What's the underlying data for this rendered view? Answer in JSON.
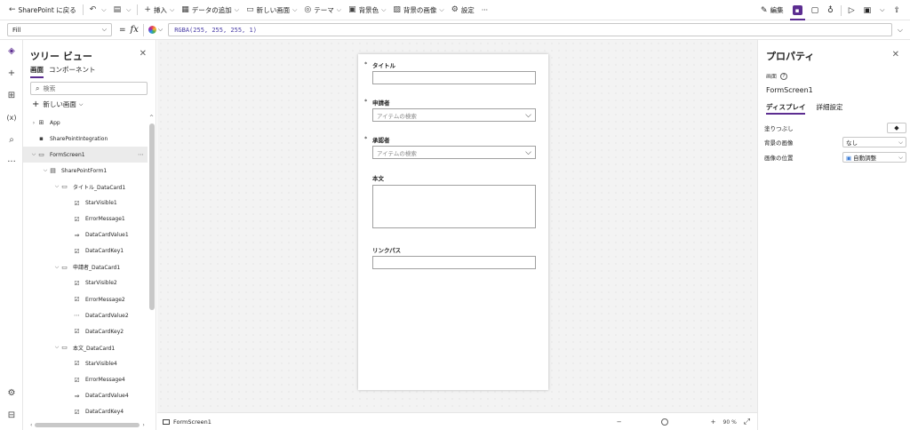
{
  "toolbar": {
    "back_label": "SharePoint に戻る",
    "insert_label": "挿入",
    "add_data_label": "データの追加",
    "new_screen_label": "新しい画面",
    "theme_label": "テーマ",
    "bg_color_label": "背景色",
    "bg_image_label": "背景の画像",
    "settings_label": "設定",
    "more_label": "···",
    "edit_label": "編集"
  },
  "formula_bar": {
    "property": "Fill",
    "equals": "=",
    "fx": "fx",
    "formula": "RGBA(255, 255, 255, 1)"
  },
  "tree_view": {
    "title": "ツリー ビュー",
    "tabs": [
      "画面",
      "コンポーネント"
    ],
    "search_placeholder": "検索",
    "new_screen": "新しい画面",
    "nodes": [
      {
        "label": "App",
        "icon": "app-icon"
      },
      {
        "label": "SharePointIntegration",
        "icon": "sharepoint-integration-icon"
      },
      {
        "label": "FormScreen1",
        "icon": "screen-icon"
      },
      {
        "label": "SharePointForm1",
        "icon": "form-icon"
      },
      {
        "label": "タイトル_DataCard1",
        "icon": "datacard-icon"
      },
      {
        "label": "StarVisible1",
        "icon": "label-icon"
      },
      {
        "label": "ErrorMessage1",
        "icon": "label-icon"
      },
      {
        "label": "DataCardValue1",
        "icon": "textinput-icon"
      },
      {
        "label": "DataCardKey1",
        "icon": "label-icon"
      },
      {
        "label": "申請者_DataCard1",
        "icon": "datacard-icon"
      },
      {
        "label": "StarVisible2",
        "icon": "label-icon"
      },
      {
        "label": "ErrorMessage2",
        "icon": "label-icon"
      },
      {
        "label": "DataCardValue2",
        "icon": "combobox-icon"
      },
      {
        "label": "DataCardKey2",
        "icon": "label-icon"
      },
      {
        "label": "本文_DataCard1",
        "icon": "datacard-icon"
      },
      {
        "label": "StarVisible4",
        "icon": "label-icon"
      },
      {
        "label": "ErrorMessage4",
        "icon": "label-icon"
      },
      {
        "label": "DataCardValue4",
        "icon": "textinput-icon"
      },
      {
        "label": "DataCardKey4",
        "icon": "label-icon"
      }
    ]
  },
  "form": {
    "title_label": "タイトル",
    "applicant_label": "申請者",
    "applicant_placeholder": "アイテムの検索",
    "approver_label": "承認者",
    "approver_placeholder": "アイテムの検索",
    "body_label": "本文",
    "link_label": "リンクパス",
    "star": "*"
  },
  "status": {
    "screen_name": "FormScreen1",
    "zoom_minus": "−",
    "zoom_plus": "+",
    "zoom_value": "90 %"
  },
  "properties": {
    "title": "プロパティ",
    "type": "画面",
    "name": "FormScreen1",
    "tabs": [
      "ディスプレイ",
      "詳細設定"
    ],
    "fill_label": "塗りつぶし",
    "bg_image_label": "背景の画像",
    "bg_image_value": "なし",
    "image_pos_label": "画像の位置",
    "image_pos_value": "自動調整"
  },
  "colors": {
    "accent": "#5c2d91",
    "formula_text": "#4b3fa6"
  }
}
